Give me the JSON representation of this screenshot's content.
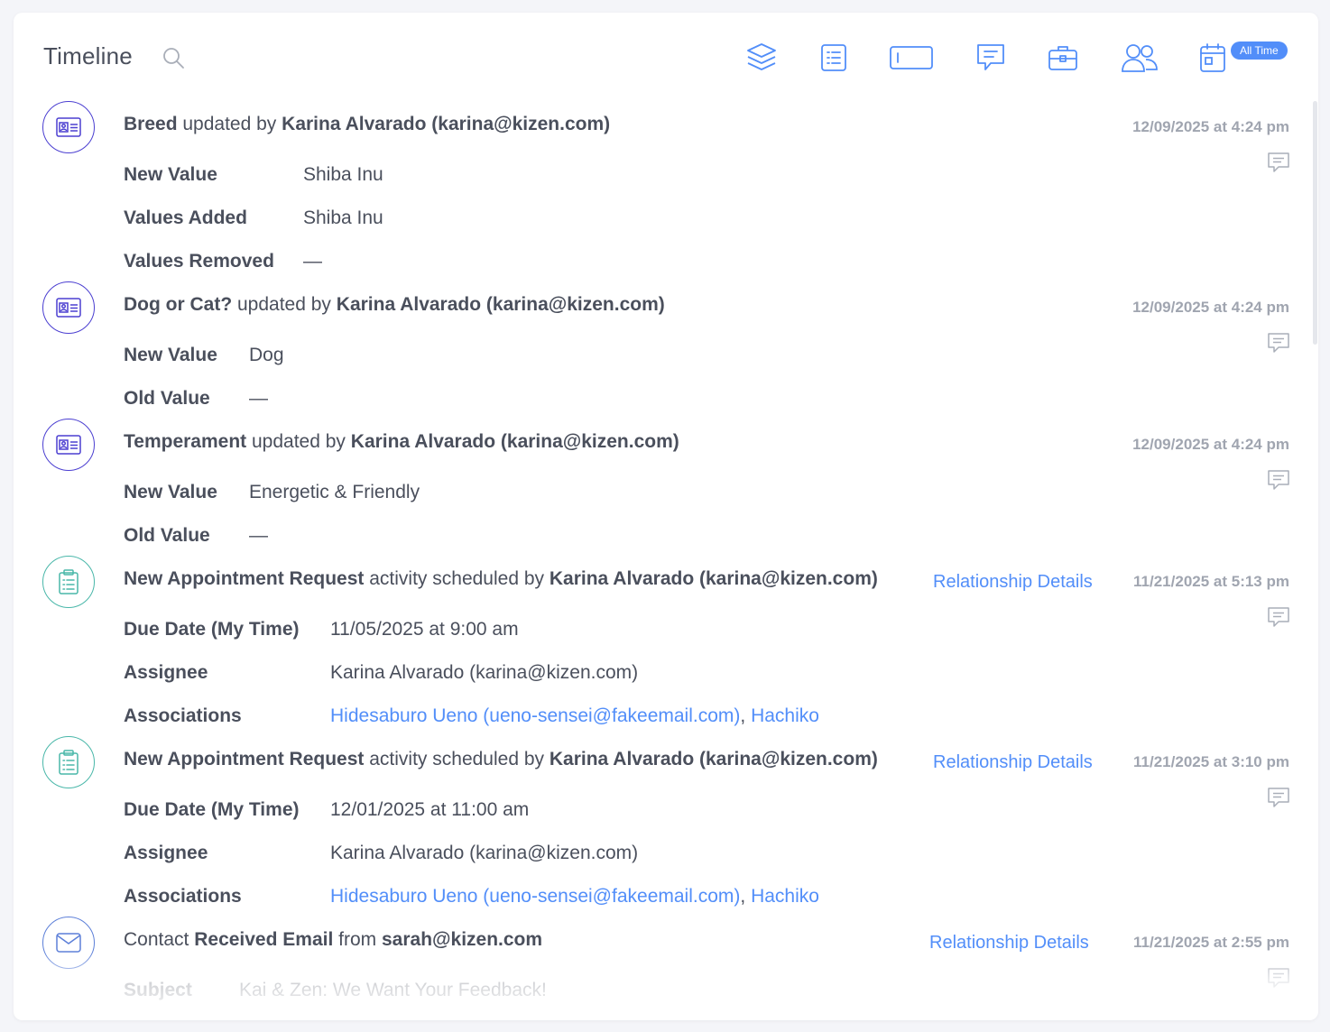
{
  "header": {
    "title": "Timeline",
    "search_icon": "search-icon",
    "filter_icons": [
      "layers-icon",
      "list-icon",
      "field-icon",
      "message-icon",
      "briefcase-icon",
      "people-icon",
      "calendar-icon"
    ],
    "date_badge": "All Time"
  },
  "colors": {
    "accent": "#528ef9",
    "field_update_icon": "#4b3fd1",
    "activity_icon": "#49b7a9",
    "email_icon": "#5c7fd8",
    "text": "#4a4f5c",
    "timestamp": "#a0a5b0"
  },
  "entries": [
    {
      "icon": "id-card-icon",
      "field": "Breed",
      "verb": "updated by",
      "user": "Karina Alvarado (karina@kizen.com)",
      "timestamp": "12/09/2025 at 4:24 pm",
      "rows": [
        {
          "label": "New Value",
          "value": "Shiba Inu"
        },
        {
          "label": "Values Added",
          "value": "Shiba Inu"
        },
        {
          "label": "Values Removed",
          "value": "—"
        }
      ]
    },
    {
      "icon": "id-card-icon",
      "field": "Dog or Cat?",
      "verb": "updated by",
      "user": "Karina Alvarado (karina@kizen.com)",
      "timestamp": "12/09/2025 at 4:24 pm",
      "rows": [
        {
          "label": "New Value",
          "value": "Dog"
        },
        {
          "label": "Old Value",
          "value": "—"
        }
      ]
    },
    {
      "icon": "id-card-icon",
      "field": "Temperament",
      "verb": "updated by",
      "user": "Karina Alvarado (karina@kizen.com)",
      "timestamp": "12/09/2025 at 4:24 pm",
      "rows": [
        {
          "label": "New Value",
          "value": "Energetic & Friendly"
        },
        {
          "label": "Old Value",
          "value": "—"
        }
      ]
    },
    {
      "icon": "clipboard-icon",
      "activity": "New Appointment Request",
      "verb": "activity scheduled by",
      "user": "Karina Alvarado (karina@kizen.com)",
      "relationship_link": "Relationship Details",
      "timestamp": "11/21/2025 at 5:13 pm",
      "due_label": "Due Date (My Time)",
      "due_value": "11/05/2025 at 9:00 am",
      "assignee_label": "Assignee",
      "assignee_value": "Karina Alvarado (karina@kizen.com)",
      "associations_label": "Associations",
      "association_1": "Hidesaburo Ueno (ueno-sensei@fakeemail.com)",
      "separator": ",",
      "association_2": "Hachiko"
    },
    {
      "icon": "clipboard-icon",
      "activity": "New Appointment Request",
      "verb": "activity scheduled by",
      "user": "Karina Alvarado (karina@kizen.com)",
      "relationship_link": "Relationship Details",
      "timestamp": "11/21/2025 at 3:10 pm",
      "due_label": "Due Date (My Time)",
      "due_value": "12/01/2025 at 11:00 am",
      "assignee_label": "Assignee",
      "assignee_value": "Karina Alvarado (karina@kizen.com)",
      "associations_label": "Associations",
      "association_1": "Hidesaburo Ueno (ueno-sensei@fakeemail.com)",
      "separator": ",",
      "association_2": "Hachiko"
    },
    {
      "icon": "envelope-icon",
      "prefix": "Contact",
      "event": "Received Email",
      "from_word": "from",
      "sender": "sarah@kizen.com",
      "relationship_link": "Relationship Details",
      "timestamp": "11/21/2025 at 2:55 pm",
      "subject_label": "Subject",
      "subject_value": "Kai & Zen: We Want Your Feedback!"
    }
  ]
}
